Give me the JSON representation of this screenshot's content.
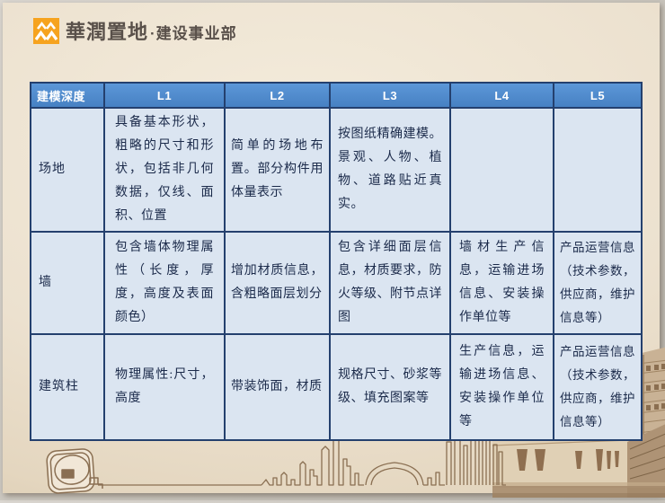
{
  "slide": {
    "brand": "華潤置地",
    "division": "·建设事业部"
  },
  "table": {
    "columns": [
      "建模深度",
      "L1",
      "L2",
      "L3",
      "L4",
      "L5"
    ],
    "rows": [
      {
        "label": "场地",
        "cells": [
          "具备基本形状，粗略的尺寸和形状，包括非几何数据，仅线、面积、位置",
          "简单的场地布置。部分构件用体量表示",
          "按图纸精确建模。景观、人物、植物、道路贴近真实。",
          "",
          ""
        ]
      },
      {
        "label": "墙",
        "cells": [
          "包含墙体物理属性（长度，厚度，高度及表面颜色）",
          "增加材质信息，含粗略面层划分",
          "包含详细面层信息，材质要求，防火等级、附节点详图",
          "墙材生产信息，运输进场信息、安装操作单位等",
          "产品运营信息（技术参数，供应商，维护信息等）"
        ]
      },
      {
        "label": "建筑柱",
        "cells": [
          "物理属性:尺寸，高度",
          "带装饰面，材质",
          "规格尺寸、砂浆等级、填充图案等",
          "生产信息，运输进场信息、安装操作单位等",
          "产品运营信息（技术参数，供应商，维护信息等）"
        ]
      }
    ]
  },
  "colors": {
    "header_bg": "#4e8bcb",
    "cell_bg": "#dbe5f1",
    "table_border": "#24406e",
    "cell_text": "#1b2a4a",
    "slide_bg": "#ece1cf",
    "logo_orange": "#f6a31f",
    "sketch_brown": "#8a6f52",
    "title_text": "#59504a"
  },
  "icons": {
    "logo": "cr-mountains-icon",
    "tape_measure": "tape-measure-icon",
    "skyline": "city-skyline-sketch",
    "photo": "building-photo"
  }
}
